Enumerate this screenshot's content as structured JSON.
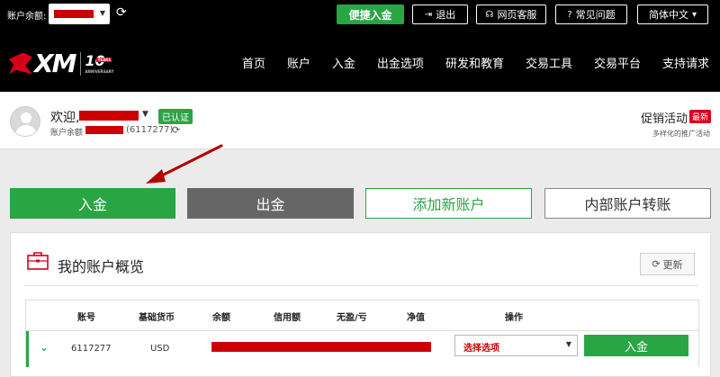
{
  "topbar": {
    "balance_label": "账户余额:",
    "quick_deposit": "便捷入金",
    "logout": "退出",
    "support": "网页客服",
    "faq": "常见问题",
    "language": "简体中文"
  },
  "logo": {
    "text": "XM",
    "anniversary_number": "10",
    "anniversary_years": "YEARS",
    "anniversary_sub": "ANNIVERSARY"
  },
  "nav": {
    "items": [
      "首页",
      "账户",
      "入金",
      "出金选项",
      "研发和教育",
      "交易工具",
      "交易平台",
      "支持请求"
    ]
  },
  "welcome": {
    "greeting": "欢迎,",
    "verified": "已认证",
    "balance_label": "账户余额",
    "account_suffix": "(6117277)",
    "promo_title": "促销活动",
    "promo_badge": "最新",
    "promo_sub": "多样化的推广活动"
  },
  "actions": {
    "deposit": "入金",
    "withdraw": "出金",
    "add_account": "添加新账户",
    "internal_transfer": "内部账户转账"
  },
  "overview": {
    "title": "我的账户概览",
    "refresh": "更新",
    "columns": [
      "账号",
      "基础货币",
      "余额",
      "信用额",
      "无盈/亏",
      "净值",
      "操作"
    ],
    "rows": [
      {
        "account": "6117277",
        "currency": "USD",
        "select_placeholder": "选择选项",
        "deposit": "入金"
      }
    ]
  },
  "colors": {
    "brand_green": "#2aa544",
    "brand_red": "#d6001c",
    "redaction": "#c00000"
  }
}
